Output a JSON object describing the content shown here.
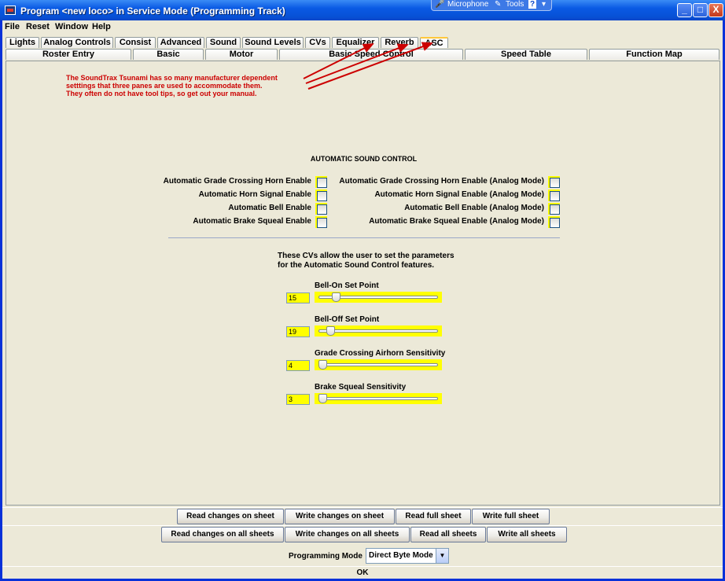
{
  "window": {
    "title": "Program <new loco> in Service Mode (Programming Track)",
    "tray": {
      "microphone": "Microphone",
      "tools": "Tools",
      "help_glyph": "?"
    },
    "controls": {
      "minimize": "_",
      "maximize": "□",
      "close": "X"
    }
  },
  "menu": [
    "File",
    "Reset",
    "Window",
    "Help"
  ],
  "tabs_top": [
    "Lights",
    "Analog Controls",
    "Consist",
    "Advanced",
    "Sound",
    "Sound Levels",
    "CVs",
    "Equalizer",
    "Reverb",
    "ASC"
  ],
  "tabs_bottom": [
    "Roster Entry",
    "Basic",
    "Motor",
    "Basic Speed Control",
    "Speed Table",
    "Function Map"
  ],
  "annotation": {
    "line1": "The SoundTrax Tsunami has so many manufacturer dependent",
    "line2": "setttings that three panes are used to  accommodate them.",
    "line3": "They often do not have tool tips, so get out your manual."
  },
  "section_title": "AUTOMATIC SOUND CONTROL",
  "checkboxes_left": [
    "Automatic Grade Crossing Horn Enable",
    "Automatic Horn Signal Enable",
    "Automatic Bell Enable",
    "Automatic Brake Squeal Enable"
  ],
  "checkboxes_right": [
    "Automatic Grade Crossing Horn Enable (Analog Mode)",
    "Automatic Horn Signal Enable (Analog Mode)",
    "Automatic Bell Enable (Analog Mode)",
    "Automatic Brake Squeal Enable (Analog Mode)"
  ],
  "params_text": {
    "line1": "These CVs allow the user to set the parameters",
    "line2": "for the Automatic Sound Control features."
  },
  "sliders": [
    {
      "label": "Bell-On Set Point",
      "value": "15",
      "level": 0.12
    },
    {
      "label": "Bell-Off Set Point",
      "value": "19",
      "level": 0.07
    },
    {
      "label": "Grade Crossing Airhorn Sensitivity",
      "value": "4",
      "level": 0.0
    },
    {
      "label": "Brake Squeal Sensitivity",
      "value": "3",
      "level": 0.0
    }
  ],
  "buttons_sheet": [
    "Read changes on sheet",
    "Write changes on sheet",
    "Read full sheet",
    "Write full sheet"
  ],
  "buttons_all": [
    "Read changes on all sheets",
    "Write changes on all sheets",
    "Read all sheets",
    "Write all sheets"
  ],
  "programming_mode": {
    "label": "Programming Mode",
    "value": "Direct Byte Mode"
  },
  "ok_label": "OK",
  "colors": {
    "highlight": "#ffff00",
    "annotation": "#cc0000",
    "title_bar": "#0a5ae4"
  }
}
